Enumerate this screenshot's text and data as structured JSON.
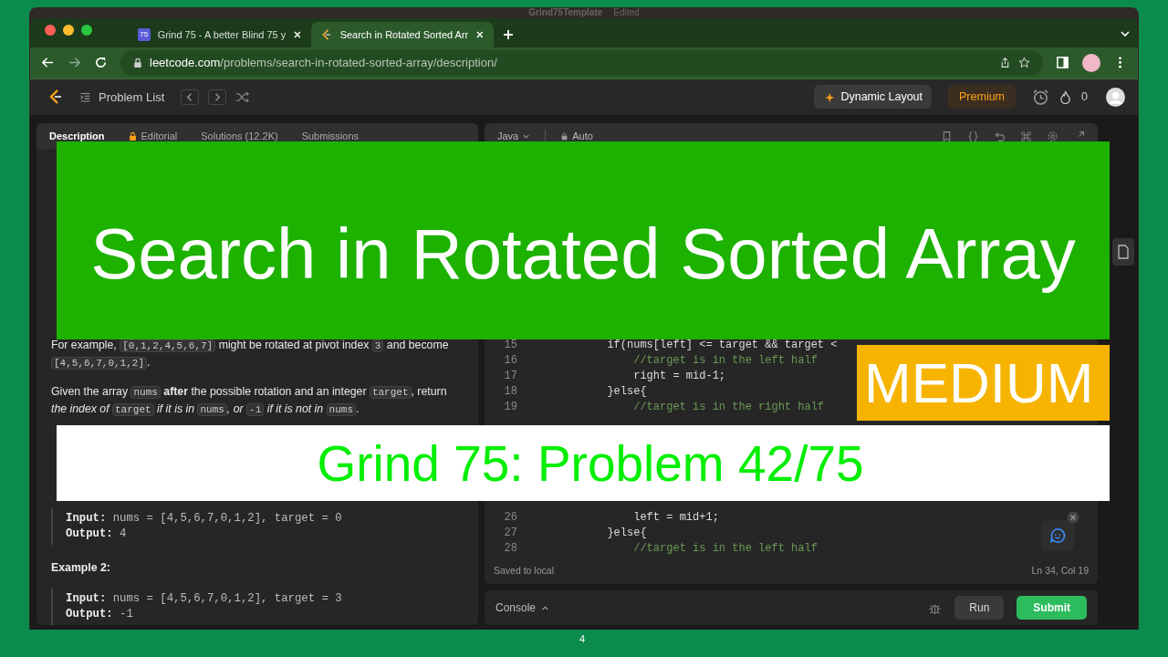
{
  "os_window": {
    "title": "Grind75Template",
    "status": "Edited"
  },
  "browser": {
    "tabs": [
      {
        "kind": "grind",
        "badge": "75",
        "label": "Grind 75 - A better Blind 75 y",
        "selected": false
      },
      {
        "kind": "leetcode",
        "label": "Search in Rotated Sorted Arr",
        "selected": true
      }
    ],
    "url_host": "leetcode.com",
    "url_path": "/problems/search-in-rotated-sorted-array/description/"
  },
  "nav": {
    "problem_list": "Problem List",
    "dynamic_layout": "Dynamic Layout",
    "premium": "Premium",
    "streak": "0"
  },
  "problem": {
    "tabs": [
      {
        "label": "Description",
        "locked": false,
        "selected": true
      },
      {
        "label": "Editorial",
        "locked": true,
        "selected": false
      },
      {
        "label": "Solutions (12.2K)",
        "locked": false,
        "selected": false
      },
      {
        "label": "Submissions",
        "locked": false,
        "selected": false
      }
    ],
    "paragraphs": [
      {
        "segments": [
          {
            "kind": "text",
            "t": "For example, "
          },
          {
            "kind": "code",
            "t": "[0,1,2,4,5,6,7]"
          },
          {
            "kind": "text",
            "t": " might be rotated at pivot index "
          },
          {
            "kind": "code",
            "t": "3"
          },
          {
            "kind": "text",
            "t": " and become "
          },
          {
            "kind": "code",
            "t": "[4,5,6,7,0,1,2]"
          },
          {
            "kind": "text",
            "t": "."
          }
        ]
      },
      {
        "segments": [
          {
            "kind": "text",
            "t": "Given the array "
          },
          {
            "kind": "code",
            "t": "nums"
          },
          {
            "kind": "bold",
            "t": " after"
          },
          {
            "kind": "text",
            "t": " the possible rotation and an integer "
          },
          {
            "kind": "code",
            "t": "target"
          },
          {
            "kind": "text",
            "t": ", return "
          },
          {
            "kind": "italic",
            "t": "the index of "
          },
          {
            "kind": "code",
            "t": "target"
          },
          {
            "kind": "italic",
            "t": " if it is in "
          },
          {
            "kind": "code",
            "t": "nums"
          },
          {
            "kind": "italic",
            "t": ", or "
          },
          {
            "kind": "code",
            "t": "-1"
          },
          {
            "kind": "italic",
            "t": " if it is not in "
          },
          {
            "kind": "code",
            "t": "nums"
          },
          {
            "kind": "text",
            "t": "."
          }
        ]
      }
    ],
    "examples": [
      {
        "input_label": "Input:",
        "input": "nums = [4,5,6,7,0,1,2], target = 0",
        "output_label": "Output:",
        "output": "4"
      },
      {
        "title": "Example 2:",
        "input_label": "Input:",
        "input": "nums = [4,5,6,7,0,1,2], target = 3",
        "output_label": "Output:",
        "output": "-1"
      }
    ]
  },
  "editor": {
    "language": "Java",
    "mode": "Auto",
    "lines_top": [
      {
        "number": "15",
        "kind": "code",
        "code": "            if(nums[left] <= target && target <"
      },
      {
        "number": "16",
        "kind": "comment",
        "code": "                //target is in the left half"
      },
      {
        "number": "17",
        "kind": "code",
        "code": "                right = mid-1;"
      },
      {
        "number": "18",
        "kind": "code",
        "code": "            }else{"
      },
      {
        "number": "19",
        "kind": "comment",
        "code": "                //target is in the right half"
      }
    ],
    "lines_bottom": [
      {
        "number": "26",
        "kind": "code",
        "code": "                left = mid+1;"
      },
      {
        "number": "27",
        "kind": "code",
        "code": "            }else{"
      },
      {
        "number": "28",
        "kind": "comment",
        "code": "                //target is in the left half"
      }
    ],
    "saved": "Saved to local",
    "cursor": "Ln 34, Col 19"
  },
  "console": {
    "label": "Console",
    "run": "Run",
    "submit": "Submit"
  },
  "overlay": {
    "title": "Search in Rotated Sorted Array",
    "difficulty": "MEDIUM",
    "subtitle": "Grind 75: Problem 42/75"
  },
  "page_number": "4"
}
